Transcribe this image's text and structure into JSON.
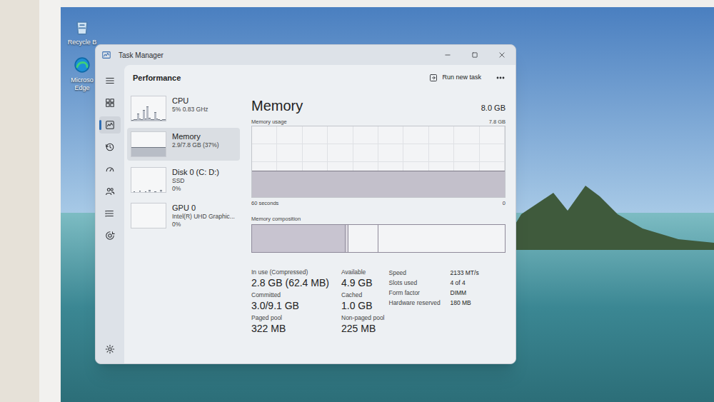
{
  "window": {
    "title": "Task Manager"
  },
  "desktop_icons": [
    {
      "label": "Recycle B"
    },
    {
      "label": "Microso Edge"
    }
  ],
  "nav_items": [
    {
      "selected": false
    },
    {
      "selected": true
    },
    {
      "selected": false
    },
    {
      "selected": false
    },
    {
      "selected": false
    },
    {
      "selected": false
    },
    {
      "selected": false
    }
  ],
  "header": {
    "title": "Performance",
    "run_task": "Run new task"
  },
  "resources": [
    {
      "name": "CPU",
      "details": [
        "5% 0.83 GHz"
      ],
      "selected": false,
      "values": [
        4,
        6,
        5,
        30,
        8,
        5,
        45,
        10,
        60,
        12,
        6,
        5,
        35,
        8,
        5,
        4,
        6,
        5
      ]
    },
    {
      "name": "Memory",
      "details": [
        "2.9/7.8 GB (37%)"
      ],
      "selected": true,
      "values": [
        37,
        37,
        37,
        37,
        37,
        37,
        37,
        37,
        37,
        37,
        37,
        37,
        37,
        37,
        37,
        37,
        37,
        37
      ]
    },
    {
      "name": "Disk 0 (C: D:)",
      "details": [
        "SSD",
        "0%"
      ],
      "selected": false,
      "values": [
        0,
        2,
        0,
        0,
        6,
        0,
        0,
        3,
        0,
        10,
        0,
        0,
        4,
        0,
        0,
        8,
        0,
        0
      ]
    },
    {
      "name": "GPU 0",
      "details": [
        "Intel(R) UHD Graphic...",
        "0%"
      ],
      "selected": false,
      "values": [
        0,
        0,
        0,
        0,
        0,
        0,
        0,
        0,
        0,
        0,
        0,
        0,
        0,
        0,
        0,
        0,
        0,
        0
      ]
    }
  ],
  "memory": {
    "title": "Memory",
    "total": "8.0 GB",
    "usage_label": "Memory usage",
    "usage_max": "7.8 GB",
    "axis_max": 7.8,
    "history": [
      2.95,
      2.95,
      2.95,
      2.95,
      2.95,
      2.95,
      2.95,
      2.95,
      2.95,
      2.95,
      2.95,
      2.95,
      2.95,
      2.95,
      2.96,
      2.96,
      2.95,
      2.95,
      2.95,
      2.95,
      2.95,
      2.95,
      2.95,
      2.95,
      2.95,
      2.95,
      2.95,
      2.95,
      2.95,
      2.95
    ],
    "time_label": "60 seconds",
    "time_end": "0",
    "composition_label": "Memory composition",
    "composition": [
      {
        "kind": "in_use",
        "level": 0.37
      },
      {
        "kind": "modified",
        "level": 0.012
      },
      {
        "kind": "standby",
        "level": 0.118
      },
      {
        "kind": "free",
        "level": 0.5
      }
    ],
    "stats": [
      {
        "label": "In use (Compressed)",
        "value": "2.8 GB (62.4 MB)"
      },
      {
        "label": "Available",
        "value": "4.9 GB"
      },
      {
        "label": "Committed",
        "value": "3.0/9.1 GB"
      },
      {
        "label": "Cached",
        "value": "1.0 GB"
      },
      {
        "label": "Paged pool",
        "value": "322 MB"
      },
      {
        "label": "Non-paged pool",
        "value": "225 MB"
      }
    ],
    "specs": [
      {
        "label": "Speed",
        "value": "2133 MT/s"
      },
      {
        "label": "Slots used",
        "value": "4 of 4"
      },
      {
        "label": "Form factor",
        "value": "DIMM"
      },
      {
        "label": "Hardware reserved",
        "value": "180 MB"
      }
    ]
  }
}
